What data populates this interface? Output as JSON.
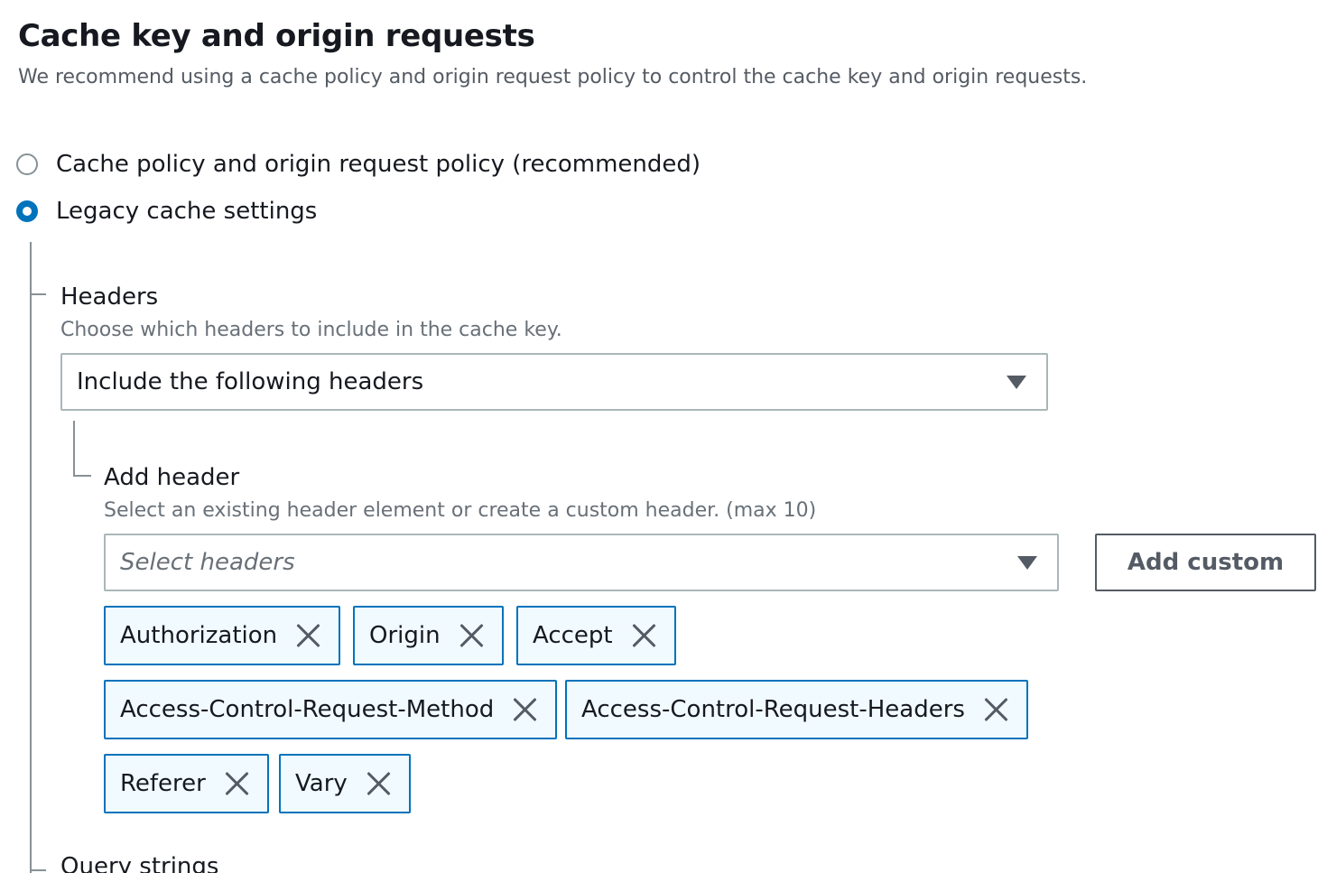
{
  "section": {
    "title": "Cache key and origin requests",
    "description": "We recommend using a cache policy and origin request policy to control the cache key and origin requests."
  },
  "options": [
    {
      "label": "Cache policy and origin request policy (recommended)",
      "selected": false
    },
    {
      "label": "Legacy cache settings",
      "selected": true
    }
  ],
  "headers": {
    "label": "Headers",
    "description": "Choose which headers to include in the cache key.",
    "select_value": "Include the following headers"
  },
  "add_header": {
    "label": "Add header",
    "description": "Select an existing header element or create a custom header. (max 10)",
    "placeholder": "Select headers",
    "add_custom_label": "Add custom"
  },
  "tags": [
    {
      "label": "Authorization"
    },
    {
      "label": "Origin"
    },
    {
      "label": "Accept"
    },
    {
      "label": "Access-Control-Request-Method"
    },
    {
      "label": "Access-Control-Request-Headers"
    },
    {
      "label": "Referer"
    },
    {
      "label": "Vary"
    }
  ],
  "query_strings": {
    "label": "Query strings"
  },
  "colors": {
    "accent": "#0073bb",
    "tag_background": "#f1faff",
    "text_primary": "#16191f",
    "text_secondary": "#687078"
  },
  "icons": {
    "select_caret": "caret-down-icon",
    "tag_dismiss": "close-icon"
  }
}
